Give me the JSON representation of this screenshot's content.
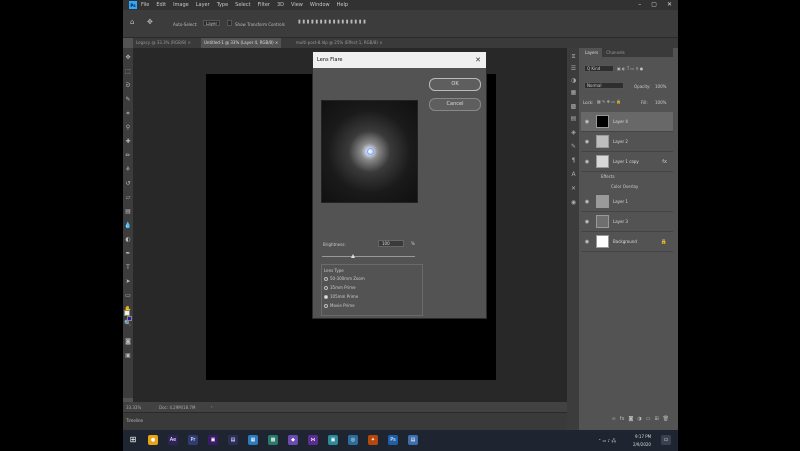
{
  "menubar": {
    "logo": "Ps",
    "items": [
      "File",
      "Edit",
      "Image",
      "Layer",
      "Type",
      "Select",
      "Filter",
      "3D",
      "View",
      "Window",
      "Help"
    ],
    "controls": [
      "–",
      "▢",
      "✕"
    ]
  },
  "options": {
    "auto_select_label": "Auto-Select:",
    "auto_select_value": "Layer",
    "transform_label": "Show Transform Controls"
  },
  "tabs": [
    {
      "label": "Legacy @ 33.3% (RGB/8) ×"
    },
    {
      "label": "Untitled-1 @ 33% (Layer 4, RGB/8) ×"
    },
    {
      "label": "multi-post-8.ldp @ 25% (Effect 1, RGB/8) ×"
    }
  ],
  "statusbar": {
    "zoom": "33.33%",
    "doc": "Doc: 4.29M/18.7M"
  },
  "timeline": {
    "label": "Timeline"
  },
  "layers_panel": {
    "tabs": [
      "Layers",
      "Channels"
    ],
    "kind_label": "Q Kind",
    "blend_mode": "Normal",
    "opacity_label": "Opacity:",
    "opacity_value": "100%",
    "lock_label": "Lock:",
    "fill_label": "Fill:",
    "fill_value": "100%",
    "layers": [
      {
        "name": "Layer 4",
        "thumb": "#000000",
        "selected": true,
        "fx": ""
      },
      {
        "name": "Layer 2",
        "thumb": "#bdbdbd",
        "selected": false,
        "fx": ""
      },
      {
        "name": "Layer 1 copy",
        "thumb": "#d8d8d8",
        "selected": false,
        "fx": "fx"
      },
      {
        "name": "Layer 1",
        "thumb": "#9a9a9a",
        "selected": false,
        "fx": ""
      },
      {
        "name": "Layer 3",
        "thumb": "#6f6f6f",
        "selected": false,
        "fx": ""
      },
      {
        "name": "Background",
        "thumb": "#ffffff",
        "selected": false,
        "fx": ""
      }
    ],
    "effects_label": "Effects",
    "effect_item": "Color Overlay"
  },
  "dialog": {
    "title": "Lens Flare",
    "close": "✕",
    "ok_label": "OK",
    "cancel_label": "Cancel",
    "brightness_label": "Brightness:",
    "brightness_value": "100",
    "brightness_unit": "%",
    "brightness_fraction": 0.33,
    "lens_type_label": "Lens Type",
    "lens_options": [
      {
        "label": "50-300mm Zoom",
        "selected": false
      },
      {
        "label": "35mm Prime",
        "selected": false
      },
      {
        "label": "105mm Prime",
        "selected": true
      },
      {
        "label": "Movie Prime",
        "selected": false
      }
    ]
  },
  "taskbar": {
    "time": "9:17 PM",
    "date": "2/9/2020"
  }
}
